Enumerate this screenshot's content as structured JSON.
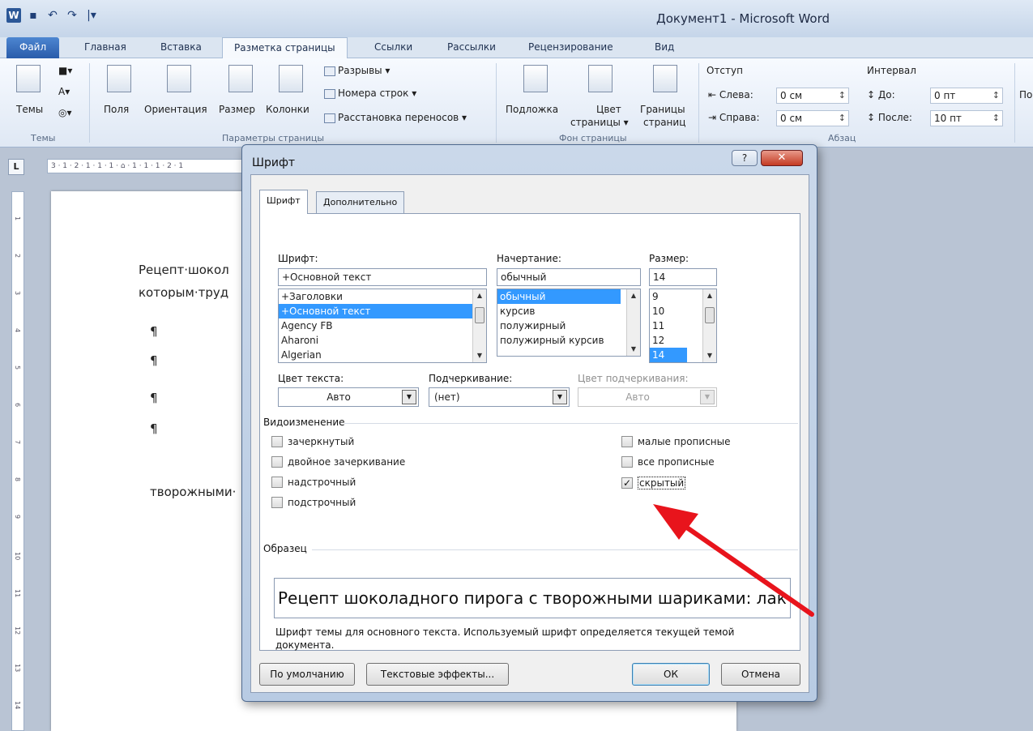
{
  "window": {
    "title": "Документ1 - Microsoft Word"
  },
  "qat": {
    "app_icon": "W",
    "save": "▪",
    "undo": "↶",
    "redo": "↷",
    "customize": "|▾"
  },
  "tabs": [
    "Файл",
    "Главная",
    "Вставка",
    "Разметка страницы",
    "Ссылки",
    "Рассылки",
    "Рецензирование",
    "Вид"
  ],
  "ribbon": {
    "themes": {
      "label": "Темы",
      "group": "Темы"
    },
    "page_setup": {
      "margins": "Поля",
      "orientation": "Ориентация",
      "size": "Размер",
      "columns": "Колонки",
      "breaks": "Разрывы ▾",
      "line_numbers": "Номера строк ▾",
      "hyphenation": "Расстановка переносов ▾",
      "group": "Параметры страницы"
    },
    "page_background": {
      "watermark": "Подложка",
      "page_color_1": "Цвет",
      "page_color_2": "страницы ▾",
      "page_borders_1": "Границы",
      "page_borders_2": "страниц",
      "group": "Фон страницы"
    },
    "paragraph": {
      "indent": "Отступ",
      "left_label": "Слева:",
      "left_value": "0 см",
      "right_label": "Справа:",
      "right_value": "0 см",
      "spacing": "Интервал",
      "before_label": "До:",
      "before_value": "0 пт",
      "after_label": "После:",
      "after_value": "10 пт",
      "group": "Абзац",
      "more": "По"
    }
  },
  "ruler": {
    "h": "3 · 1 · 2 · 1 · 1 · 1 · ⌂ · 1 · 1 · 1 · 2 · 1",
    "v": [
      "1",
      "2",
      "3",
      "4",
      "5",
      "6",
      "7",
      "8",
      "9",
      "10",
      "11",
      "12",
      "13",
      "14"
    ]
  },
  "document": {
    "line1": "Рецепт·шокол",
    "line2": "которым·труд",
    "pilcrow": "¶",
    "line3": "творожными·"
  },
  "dialog": {
    "title": "Шрифт",
    "help": "?",
    "close": "✕",
    "tab_font": "Шрифт",
    "tab_advanced": "Дополнительно",
    "font": {
      "label": "Шрифт:",
      "value": "+Основной текст",
      "list": [
        "+Заголовки",
        "+Основной текст",
        "Agency FB",
        "Aharoni",
        "Algerian"
      ],
      "selected_index": 1
    },
    "style": {
      "label": "Начертание:",
      "value": "обычный",
      "list": [
        "обычный",
        "курсив",
        "полужирный",
        "полужирный курсив"
      ],
      "selected_index": 0
    },
    "size": {
      "label": "Размер:",
      "value": "14",
      "list": [
        "9",
        "10",
        "11",
        "12",
        "14"
      ],
      "selected_index": 4
    },
    "font_color": {
      "label": "Цвет текста:",
      "value": "Авто"
    },
    "underline": {
      "label": "Подчеркивание:",
      "value": "(нет)"
    },
    "underline_color": {
      "label": "Цвет подчеркивания:",
      "value": "Авто"
    },
    "effects": {
      "label": "Видоизменение",
      "strikethrough": "зачеркнутый",
      "double_strikethrough": "двойное зачеркивание",
      "superscript": "надстрочный",
      "subscript": "подстрочный",
      "small_caps": "малые прописные",
      "all_caps": "все прописные",
      "hidden": "скрытый",
      "hidden_checked": "✓"
    },
    "preview": {
      "label": "Образец",
      "text": "Рецепт шоколадного пирога с творожными шариками: лак",
      "description": "Шрифт темы для основного текста. Используемый шрифт определяется текущей темой документа."
    },
    "buttons": {
      "default": "По умолчанию",
      "text_effects": "Текстовые эффекты...",
      "ok": "ОК",
      "cancel": "Отмена"
    }
  },
  "annotation": {
    "arrow_color": "#e8141c"
  }
}
